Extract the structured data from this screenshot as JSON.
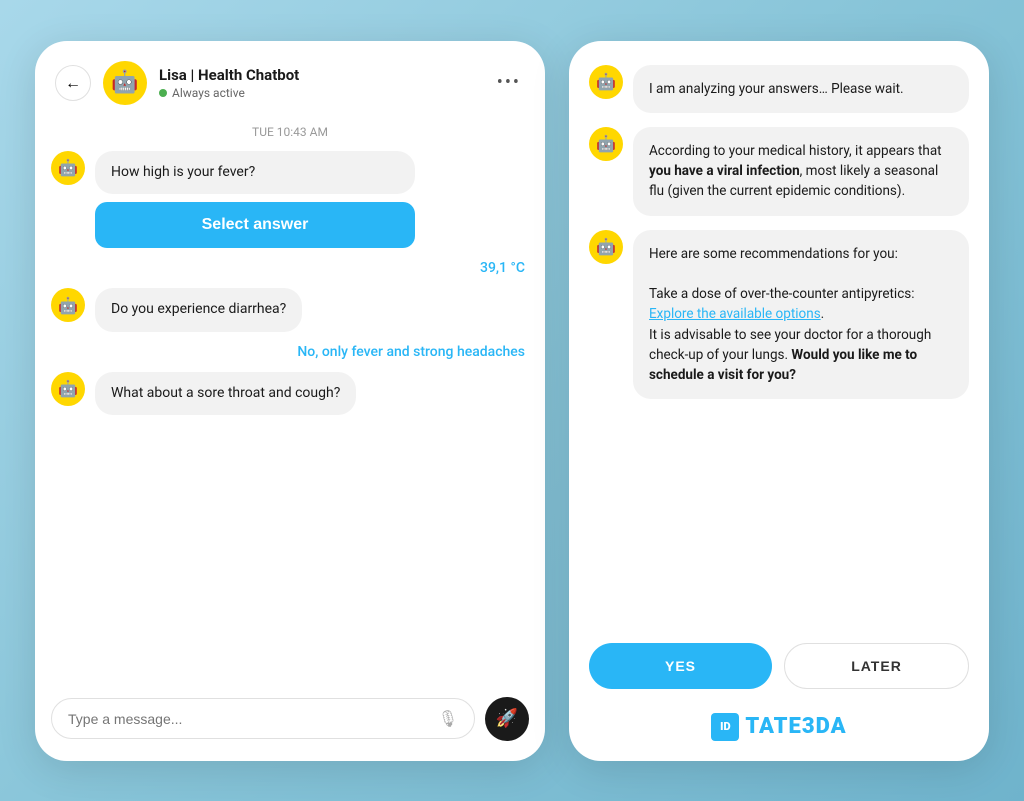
{
  "left_panel": {
    "header": {
      "back_icon": "←",
      "bot_name": "Lisa | Health Chatbot",
      "bot_status": "Always active",
      "more_icon": "•••"
    },
    "timestamp": "TUE 10:43 AM",
    "messages": [
      {
        "type": "bot",
        "text": "How high is your fever?"
      },
      {
        "type": "select_answer",
        "label": "Select answer"
      },
      {
        "type": "user",
        "text": "39,1 °C"
      },
      {
        "type": "bot",
        "text": "Do you experience diarrhea?"
      },
      {
        "type": "user_reply",
        "text": "No, only fever and strong headaches"
      },
      {
        "type": "bot",
        "text": "What about a sore throat and cough?"
      }
    ],
    "input": {
      "placeholder": "Type a message...",
      "mic_icon": "🎙",
      "send_icon": "🚀"
    }
  },
  "right_panel": {
    "messages": [
      {
        "text": "I am analyzing your answers… Please wait."
      },
      {
        "text_html": "According to your medical history, it appears that <strong>you have a viral infection</strong>, most likely a seasonal flu (given the current epidemic conditions)."
      },
      {
        "text_html": "Here are some recommendations for you:\n\nTake a dose of over-the-counter antipyretics: <a href='#'>Explore the available options</a>.\nIt is advisable to see your doctor for a thorough check-up of your lungs. <strong>Would you like me to schedule a visit for you?</strong>"
      }
    ],
    "cta": {
      "yes_label": "YES",
      "later_label": "LATER"
    },
    "brand": {
      "icon_text": "ID",
      "name": "TATE3DA"
    }
  }
}
